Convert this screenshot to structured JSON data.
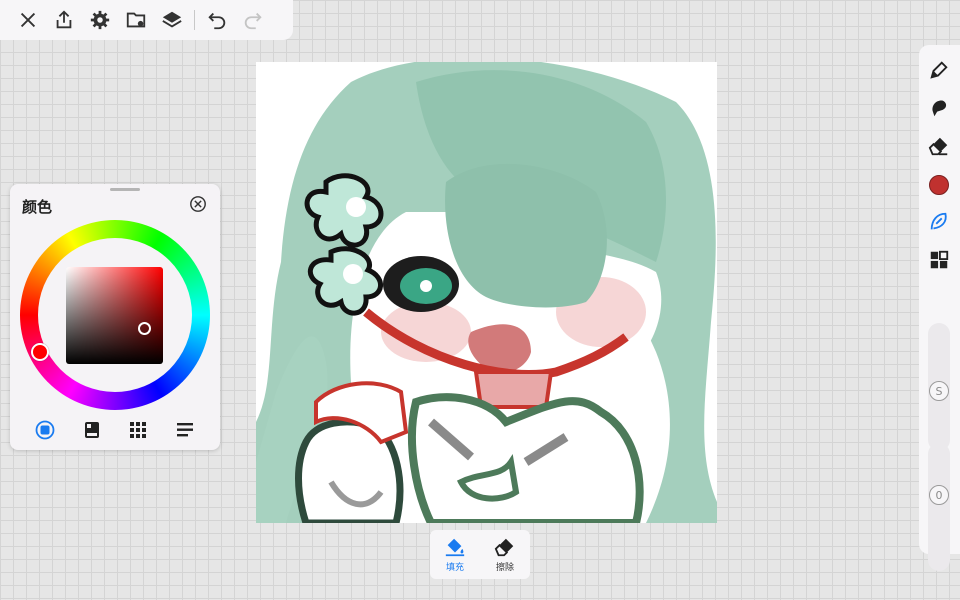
{
  "topbar": {
    "icons": [
      "close-icon",
      "share-icon",
      "gear-icon",
      "folder-icon",
      "layers-icon",
      "undo-icon",
      "redo-icon"
    ]
  },
  "color_panel": {
    "title": "颜色",
    "current_color": "#ff0000",
    "tabs": [
      "wheel-icon",
      "palette-icon",
      "grid-icon",
      "list-icon"
    ]
  },
  "right_toolbar": {
    "tools": [
      "pen-icon",
      "smudge-icon",
      "eraser-icon",
      "color-swatch",
      "lasso-icon",
      "layout-icon"
    ],
    "active_color": "#c0312f",
    "size_label": "S",
    "opacity_label": "0"
  },
  "bottom_tools": {
    "fill_label": "填充",
    "erase_label": "擦除"
  },
  "colors": {
    "accent": "#1a7bf0",
    "canvas_bg": "#ffffff"
  }
}
